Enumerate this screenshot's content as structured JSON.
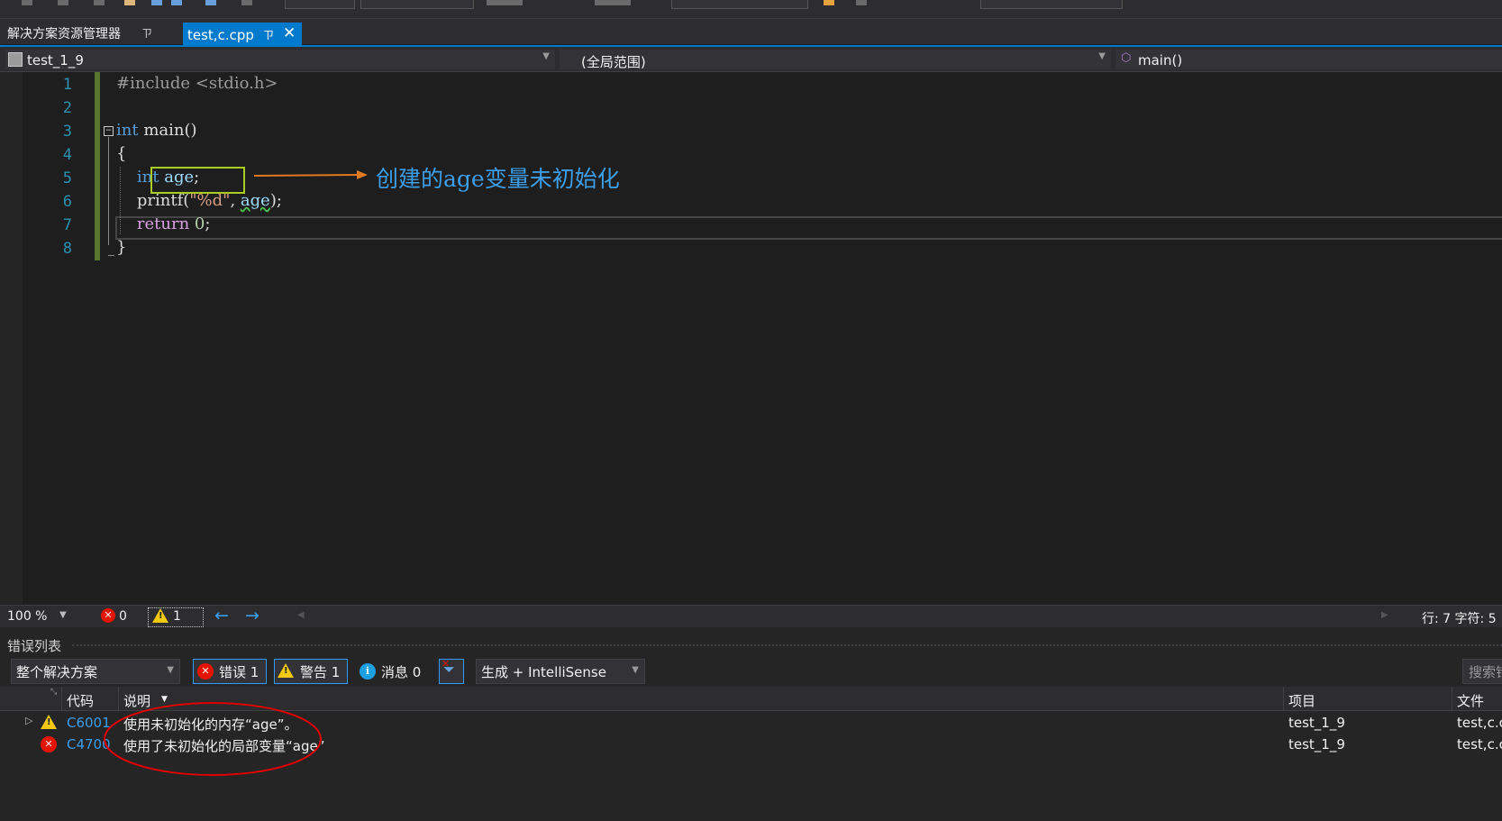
{
  "tabs": {
    "solution_explorer": "解决方案资源管理器",
    "active_file": "test,c.cpp",
    "pin_glyph": "ㄗ",
    "close_glyph": "✕"
  },
  "navbar": {
    "project": "test_1_9",
    "scope": "(全局范围)",
    "member": "main()"
  },
  "editor": {
    "line_numbers": [
      "1",
      "2",
      "3",
      "4",
      "5",
      "6",
      "7",
      "8"
    ],
    "annotation": "创建的age变量未初始化",
    "colors": {
      "line_number": "#2b91af",
      "keyword": "#569cd6",
      "highlight_box": "#aacc22",
      "arrow": "#e07a1f",
      "annotation": "#3c9ee8"
    }
  },
  "status": {
    "zoom": "100 %",
    "error_count": "0",
    "warning_count": "1",
    "position": "行: 7    字符: 5"
  },
  "error_list": {
    "title": "错误列表",
    "scope_filter": "整个解决方案",
    "errors_button": "错误 1",
    "warnings_button": "警告 1",
    "messages_button": "消息 0",
    "build_filter": "生成 + IntelliSense",
    "search_placeholder": "搜索错误列表",
    "columns": {
      "code": "代码",
      "description": "说明",
      "project": "项目",
      "file": "文件"
    },
    "rows": [
      {
        "severity": "warning",
        "code": "C6001",
        "description": "使用未初始化的内存“age”。",
        "project": "test_1_9",
        "file": "test,c.cpp"
      },
      {
        "severity": "error",
        "code": "C4700",
        "description": "使用了未初始化的局部变量“age”",
        "project": "test_1_9",
        "file": "test,c.cpp"
      }
    ],
    "colors": {
      "error": "#e51400",
      "warning": "#f2c811",
      "info": "#1ba1e2",
      "active_border": "#3399ff",
      "ellipse": "#e00000"
    }
  }
}
